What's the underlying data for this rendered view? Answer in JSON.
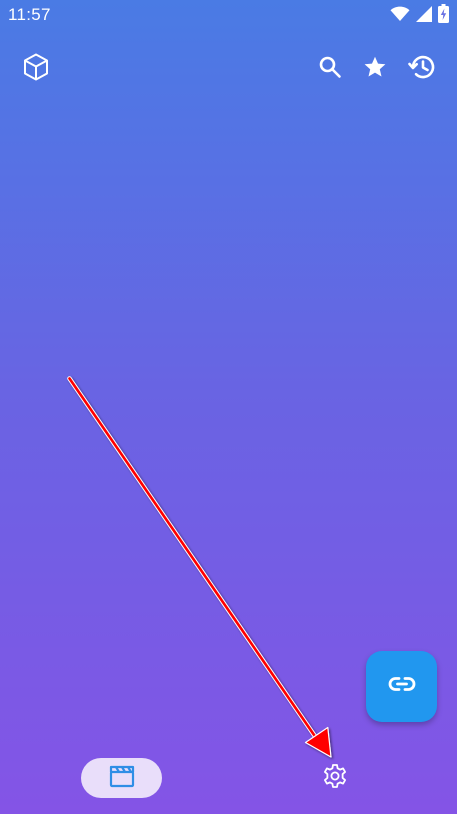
{
  "status_bar": {
    "time": "11:57",
    "icons": [
      "wifi-icon",
      "signal-icon",
      "battery-charging-icon"
    ]
  },
  "top_bar": {
    "left_icon": "cube-icon",
    "actions": [
      "search-icon",
      "star-icon",
      "history-icon"
    ]
  },
  "fab": {
    "icon": "link-icon",
    "color": "#2197ef"
  },
  "bottom_nav": {
    "items": [
      {
        "icon": "movie-clapper-icon",
        "selected": true
      },
      {
        "icon": "gear-icon",
        "selected": false
      }
    ],
    "active_pill_color": "#e9defa",
    "active_icon_color": "#2f8ee6"
  },
  "annotation": {
    "type": "arrow",
    "color": "#ff0000"
  },
  "colors": {
    "background_top": "#4a7be4",
    "background_bottom": "#8454e6"
  }
}
